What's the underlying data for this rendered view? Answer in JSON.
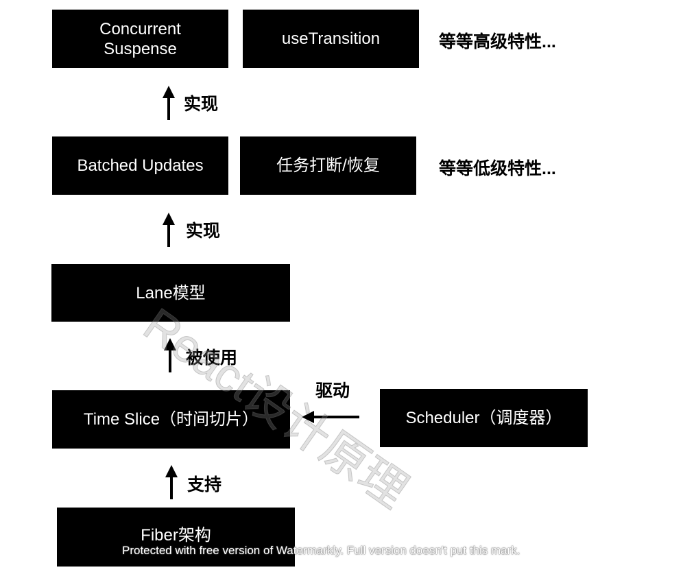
{
  "nodes": {
    "concurrent_suspense": [
      "Concurrent",
      "Suspense"
    ],
    "use_transition": "useTransition",
    "batched_updates": "Batched Updates",
    "task_interrupt": "任务打断/恢复",
    "lane_model": "Lane模型",
    "time_slice": "Time Slice（时间切片）",
    "scheduler": "Scheduler（调度器）",
    "fiber": "Fiber架构"
  },
  "side_notes": {
    "high_level": "等等高级特性...",
    "low_level": "等等低级特性..."
  },
  "edges": {
    "implements_top": "实现",
    "implements_mid": "实现",
    "used_by": "被使用",
    "drives": "驱动",
    "supports": "支持"
  },
  "watermark": "React设计原理",
  "footer_watermark": "Protected with free version of Watermarkly. Full version doesn't put this mark."
}
